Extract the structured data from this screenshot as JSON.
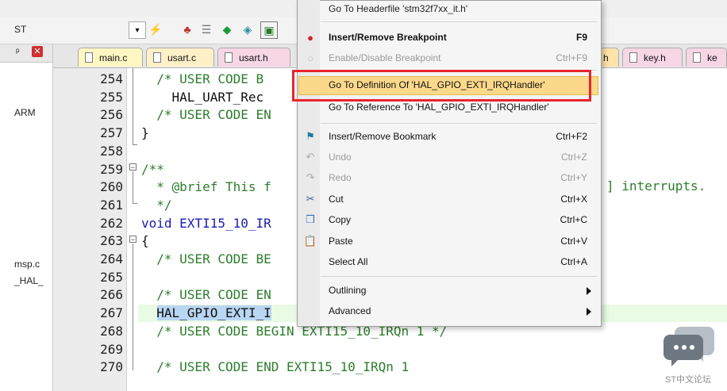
{
  "toolbar": {
    "project_label": "ST"
  },
  "left_panel": {
    "items": [
      "ARM",
      "msp.c",
      "_HAL_"
    ]
  },
  "tabs": [
    "main.c",
    "usart.c",
    "usart.h",
    "h",
    "key.h",
    "ke"
  ],
  "editor": {
    "lines": [
      {
        "num": "254",
        "code": "  /* USER CODE B"
      },
      {
        "num": "255",
        "code": "    HAL_UART_Rec"
      },
      {
        "num": "256",
        "code": "  /* USER CODE EN"
      },
      {
        "num": "257",
        "code": "}"
      },
      {
        "num": "258",
        "code": ""
      },
      {
        "num": "259",
        "code": "/**"
      },
      {
        "num": "260",
        "code": "  * @brief This f"
      },
      {
        "num": "261",
        "code": "  */"
      },
      {
        "num": "262",
        "code": "void EXTI15_10_IR"
      },
      {
        "num": "263",
        "code": "{"
      },
      {
        "num": "264",
        "code": "  /* USER CODE BE"
      },
      {
        "num": "265",
        "code": ""
      },
      {
        "num": "266",
        "code": "  /* USER CODE EN"
      },
      {
        "num": "267",
        "code": "  HAL_GPIO_EXTI_I"
      },
      {
        "num": "268",
        "code": "  /* USER CODE BEGIN EXTI15_10_IRQn 1 */"
      },
      {
        "num": "269",
        "code": ""
      },
      {
        "num": "270",
        "code": "  /* USER CODE END EXTI15_10_IRQn 1"
      }
    ],
    "right_fragment": "] interrupts."
  },
  "menu": {
    "top_partial": "Go To Headerfile 'stm32f7xx_it.h'",
    "items": [
      {
        "label": "Insert/Remove Breakpoint",
        "shortcut": "F9",
        "icon": "breakpoint-icon",
        "bold": true,
        "disabled": false
      },
      {
        "label": "Enable/Disable Breakpoint",
        "shortcut": "Ctrl+F9",
        "icon": "breakpoint-disabled-icon",
        "disabled": true
      },
      {
        "label": "Go To Definition Of 'HAL_GPIO_EXTI_IRQHandler'",
        "shortcut": "",
        "highlighted": true
      },
      {
        "label": "Go To Reference To 'HAL_GPIO_EXTI_IRQHandler'",
        "shortcut": ""
      },
      {
        "label": "Insert/Remove Bookmark",
        "shortcut": "Ctrl+F2",
        "icon": "bookmark-flag-icon"
      },
      {
        "label": "Undo",
        "shortcut": "Ctrl+Z",
        "icon": "undo-icon",
        "disabled": true
      },
      {
        "label": "Redo",
        "shortcut": "Ctrl+Y",
        "icon": "redo-icon",
        "disabled": true
      },
      {
        "label": "Cut",
        "shortcut": "Ctrl+X",
        "icon": "scissors-icon"
      },
      {
        "label": "Copy",
        "shortcut": "Ctrl+C",
        "icon": "copy-icon"
      },
      {
        "label": "Paste",
        "shortcut": "Ctrl+V",
        "icon": "paste-icon"
      },
      {
        "label": "Select All",
        "shortcut": "Ctrl+A"
      },
      {
        "label": "Outlining",
        "shortcut": "",
        "submenu": true
      },
      {
        "label": "Advanced",
        "shortcut": "",
        "submenu": true
      }
    ]
  },
  "watermark": {
    "text": "ST中文论坛"
  },
  "colors": {
    "highlight_box": "#e8242c",
    "menu_hover": "#fcd98a",
    "comment": "#2c7d2c",
    "keyword": "#1a1ab8"
  }
}
